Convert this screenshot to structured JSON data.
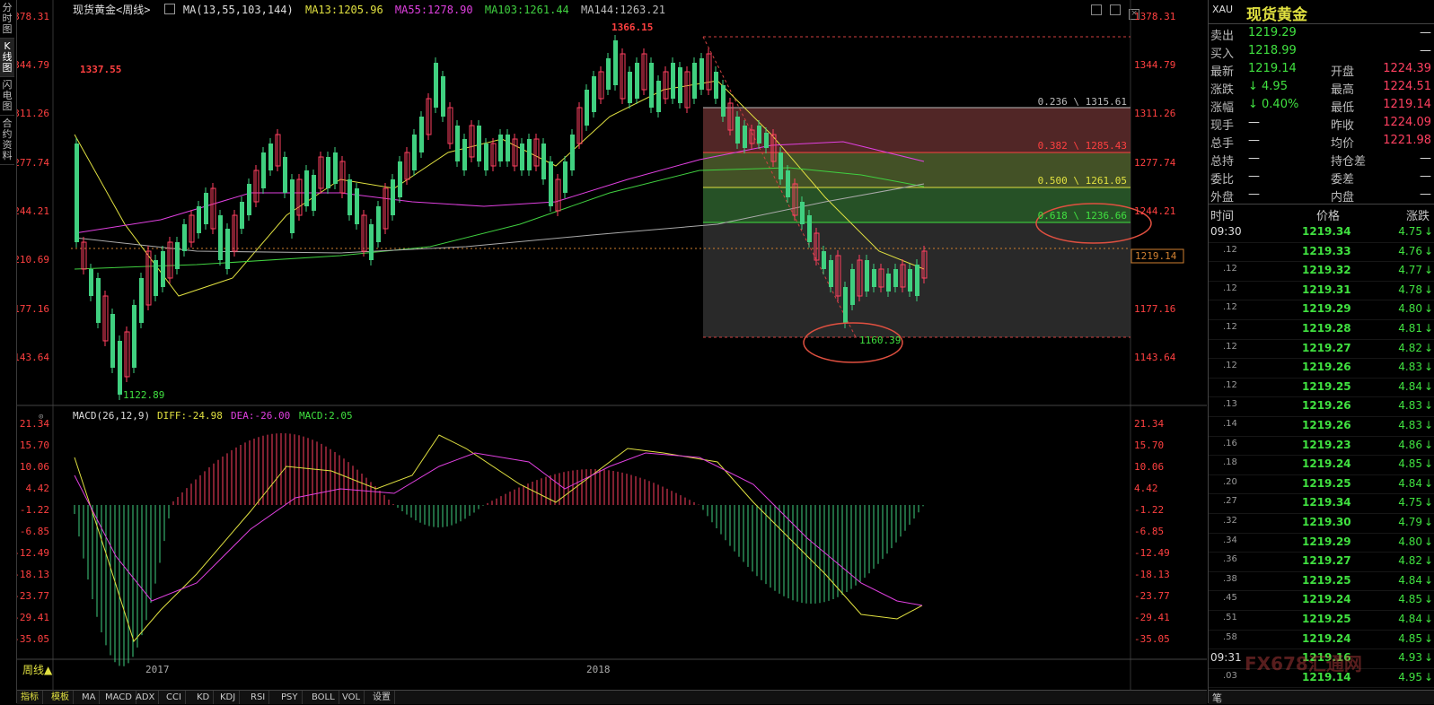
{
  "leftnav": [
    "分时图",
    "K线图",
    "闪电图",
    "合约资料"
  ],
  "header": {
    "symbol": "现货黄金<周线>",
    "ma_label": "MA(13,55,103,144)",
    "ma13": "MA13:1205.96",
    "ma55": "MA55:1278.90",
    "ma103": "MA103:1261.44",
    "ma144": "MA144:1263.21"
  },
  "price_axis": [
    "1378.31",
    "1344.79",
    "1311.26",
    "1277.74",
    "1244.21",
    "1210.69",
    "1177.16",
    "1143.64"
  ],
  "current_price_tag": "1219.14",
  "annotations": {
    "high": "1366.15",
    "low": "1122.89",
    "left_high": "1337.55",
    "recent_low": "1160.39"
  },
  "fibonacci": [
    "0.236 \\ 1315.61",
    "0.382 \\ 1285.43",
    "0.500 \\ 1261.05",
    "0.618 \\ 1236.66"
  ],
  "macd": {
    "label": "MACD(26,12,9)",
    "diff": "DIFF:-24.98",
    "dea": "DEA:-26.00",
    "macd": "MACD:2.05",
    "axis": [
      "21.34",
      "15.70",
      "10.06",
      "4.42",
      "-1.22",
      "-6.85",
      "-12.49",
      "-18.13",
      "-23.77",
      "-29.41",
      "-35.05"
    ]
  },
  "x_axis": [
    "2017",
    "2018"
  ],
  "period_button": "周线▲",
  "bottom_tabs": [
    "指标",
    "模板",
    "MA",
    "MACD",
    "ADX",
    "CCI",
    "KD",
    "KDJ",
    "RSI",
    "PSY",
    "BOLL",
    "VOL",
    "设置"
  ],
  "quote": {
    "code": "XAU",
    "name": "现货黄金",
    "rows": [
      {
        "l1": "卖出",
        "v1": "1219.29",
        "l2": "",
        "v2": "—"
      },
      {
        "l1": "买入",
        "v1": "1218.99",
        "l2": "",
        "v2": "—"
      },
      {
        "l1": "最新",
        "v1": "1219.14",
        "l2": "开盘",
        "v2": "1224.39"
      },
      {
        "l1": "涨跌",
        "v1": "↓ 4.95",
        "l2": "最高",
        "v2": "1224.51"
      },
      {
        "l1": "涨幅",
        "v1": "↓ 0.40%",
        "l2": "最低",
        "v2": "1219.14"
      },
      {
        "l1": "现手",
        "v1": "—",
        "l2": "昨收",
        "v2": "1224.09"
      },
      {
        "l1": "总手",
        "v1": "—",
        "l2": "均价",
        "v2": "1221.98"
      },
      {
        "l1": "总持",
        "v1": "—",
        "l2": "持仓差",
        "v2": "—"
      },
      {
        "l1": "委比",
        "v1": "—",
        "l2": "委差",
        "v2": "—"
      },
      {
        "l1": "外盘",
        "v1": "—",
        "l2": "内盘",
        "v2": "—"
      }
    ],
    "tick_headers": [
      "时间",
      "价格",
      "涨跌"
    ],
    "ticks": [
      {
        "t": "09:30",
        "p": "1219.34",
        "c": "4.75"
      },
      {
        "t": ".12",
        "p": "1219.33",
        "c": "4.76"
      },
      {
        "t": ".12",
        "p": "1219.32",
        "c": "4.77"
      },
      {
        "t": ".12",
        "p": "1219.31",
        "c": "4.78"
      },
      {
        "t": ".12",
        "p": "1219.29",
        "c": "4.80"
      },
      {
        "t": ".12",
        "p": "1219.28",
        "c": "4.81"
      },
      {
        "t": ".12",
        "p": "1219.27",
        "c": "4.82"
      },
      {
        "t": ".12",
        "p": "1219.26",
        "c": "4.83"
      },
      {
        "t": ".12",
        "p": "1219.25",
        "c": "4.84"
      },
      {
        "t": ".13",
        "p": "1219.26",
        "c": "4.83"
      },
      {
        "t": ".14",
        "p": "1219.26",
        "c": "4.83"
      },
      {
        "t": ".16",
        "p": "1219.23",
        "c": "4.86"
      },
      {
        "t": ".18",
        "p": "1219.24",
        "c": "4.85"
      },
      {
        "t": ".20",
        "p": "1219.25",
        "c": "4.84"
      },
      {
        "t": ".27",
        "p": "1219.34",
        "c": "4.75"
      },
      {
        "t": ".32",
        "p": "1219.30",
        "c": "4.79"
      },
      {
        "t": ".34",
        "p": "1219.29",
        "c": "4.80"
      },
      {
        "t": ".36",
        "p": "1219.27",
        "c": "4.82"
      },
      {
        "t": ".38",
        "p": "1219.25",
        "c": "4.84"
      },
      {
        "t": ".45",
        "p": "1219.24",
        "c": "4.85"
      },
      {
        "t": ".51",
        "p": "1219.25",
        "c": "4.84"
      },
      {
        "t": ".58",
        "p": "1219.24",
        "c": "4.85"
      },
      {
        "t": "09:31",
        "p": "1219.16",
        "c": "4.93"
      },
      {
        "t": ".03",
        "p": "1219.14",
        "c": "4.95"
      }
    ],
    "footer_tab": "笔",
    "watermark": "FX678汇通网"
  }
}
